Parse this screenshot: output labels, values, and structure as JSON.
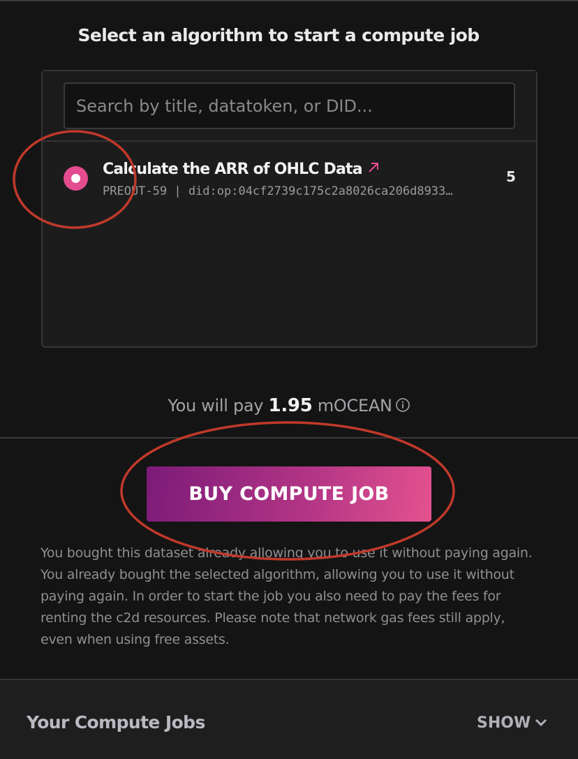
{
  "heading": "Select an algorithm to start a compute job",
  "search": {
    "placeholder": "Search by title, datatoken, or DID..."
  },
  "algorithms": [
    {
      "title": "Calculate the ARR of OHLC Data",
      "meta": "PREOUT-59 | did:op:04cf2739c175c2a8026ca206d8933…",
      "price": "5",
      "selected": true,
      "link_icon": "arrow-up-right-icon"
    }
  ],
  "payment": {
    "prefix": "You will pay",
    "amount": "1.95",
    "currency": "mOCEAN",
    "info_icon": "info-icon"
  },
  "buy_button": {
    "label": "BUY COMPUTE JOB"
  },
  "note": "You bought this dataset already allowing you to use it without paying again. You already bought the selected algorithm, allowing you to use it without paying again. In order to start the job you also need to pay the fees for renting the c2d resources. Please note that network gas fees still apply, even when using free assets.",
  "compute_jobs": {
    "title": "Your Compute Jobs",
    "toggle_label": "SHOW",
    "toggle_icon": "chevron-down-icon"
  },
  "colors": {
    "accent": "#e44c8f",
    "button_gradient_start": "#7b1b78",
    "button_gradient_end": "#e4528f",
    "annotation": "#c0392b",
    "background": "#141414"
  }
}
